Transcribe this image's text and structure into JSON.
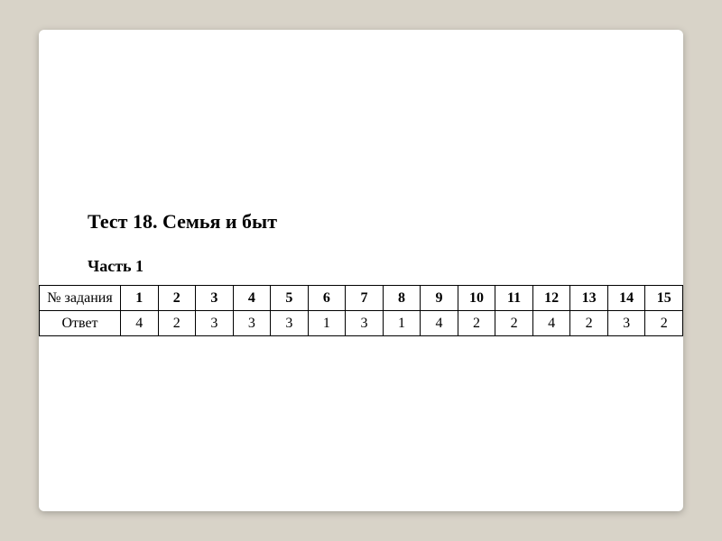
{
  "title": "Тест 18. Семья и быт",
  "part_label": "Часть 1",
  "table": {
    "header_label": "№ задания",
    "answer_label": "Ответ",
    "numbers": [
      "1",
      "2",
      "3",
      "4",
      "5",
      "6",
      "7",
      "8",
      "9",
      "10",
      "11",
      "12",
      "13",
      "14",
      "15"
    ],
    "answers": [
      "4",
      "2",
      "3",
      "3",
      "3",
      "1",
      "3",
      "1",
      "4",
      "2",
      "2",
      "4",
      "2",
      "3",
      "2"
    ]
  }
}
